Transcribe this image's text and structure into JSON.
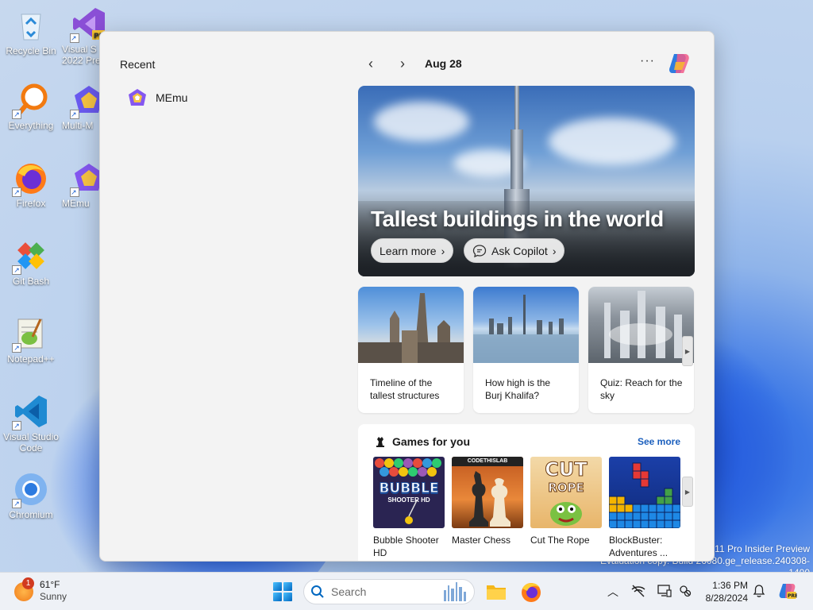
{
  "desktop": {
    "icons": [
      {
        "label": "Recycle Bin"
      },
      {
        "label": "Visual S\n2022 Pre"
      },
      {
        "label": "Everything"
      },
      {
        "label": "Multi-M"
      },
      {
        "label": "Firefox"
      },
      {
        "label": "MEmu"
      },
      {
        "label": "Git Bash"
      },
      {
        "label": "Notepad++"
      },
      {
        "label": "Visual Studio\nCode"
      },
      {
        "label": "Chromium"
      }
    ],
    "watermark": {
      "line1": "11 Pro Insider Preview",
      "line2": "Evaluation copy. Build 26080.ge_release.240308-1400"
    }
  },
  "panel": {
    "recent_title": "Recent",
    "recent_items": [
      {
        "label": "MEmu"
      }
    ],
    "date": "Aug 28",
    "more_label": "···",
    "hero": {
      "title": "Tallest buildings in the world",
      "learn_more": "Learn more",
      "ask_copilot": "Ask Copilot"
    },
    "cards": [
      {
        "caption": "Timeline of the tallest structures"
      },
      {
        "caption": "How high is the Burj Khalifa?"
      },
      {
        "caption": "Quiz: Reach for the sky"
      }
    ],
    "games": {
      "title": "Games for you",
      "see_more": "See more",
      "items": [
        {
          "name": "Bubble Shooter HD",
          "art_text": "BUBBLE",
          "art_sub": "SHOOTER HD"
        },
        {
          "name": "Master Chess",
          "art_text": "CODETHISLAB"
        },
        {
          "name": "Cut The Rope",
          "art_text": "CUT",
          "art_sub": "ROPE"
        },
        {
          "name": "BlockBuster: Adventures ..."
        }
      ]
    }
  },
  "taskbar": {
    "weather": {
      "temp": "61°F",
      "condition": "Sunny",
      "badge": "1"
    },
    "search_placeholder": "Search",
    "clock": {
      "time": "1:36 PM",
      "date": "8/28/2024"
    }
  },
  "colors": {
    "accent": "#0067c0",
    "link": "#1b5fbd",
    "panel_bg": "#f3f3f3"
  }
}
